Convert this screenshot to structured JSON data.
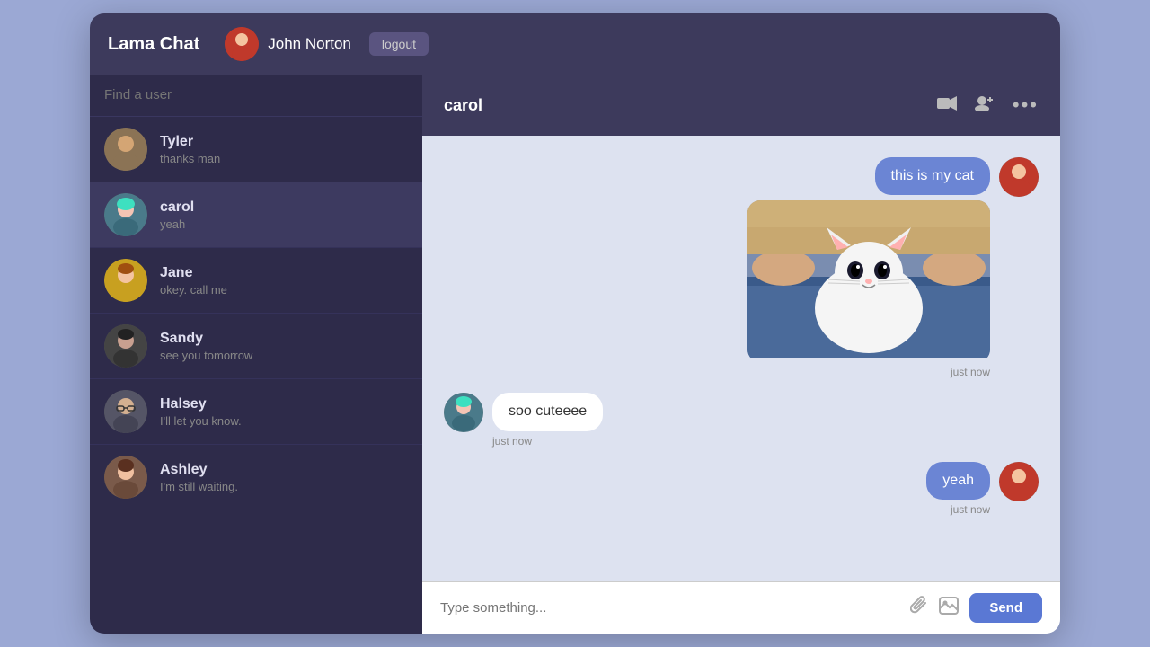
{
  "app": {
    "title": "Lama Chat",
    "logged_in_user": "John Norton",
    "logout_label": "logout"
  },
  "sidebar": {
    "search_placeholder": "Find a user",
    "contacts": [
      {
        "id": "tyler",
        "name": "Tyler",
        "preview": "thanks man",
        "active": false
      },
      {
        "id": "carol",
        "name": "carol",
        "preview": "yeah",
        "active": true
      },
      {
        "id": "jane",
        "name": "Jane",
        "preview": "okey. call me",
        "active": false
      },
      {
        "id": "sandy",
        "name": "Sandy",
        "preview": "see you tomorrow",
        "active": false
      },
      {
        "id": "halsey",
        "name": "Halsey",
        "preview": "I'll let you know.",
        "active": false
      },
      {
        "id": "ashley",
        "name": "Ashley",
        "preview": "I'm still waiting.",
        "active": false
      }
    ]
  },
  "chat": {
    "contact_name": "carol",
    "messages": [
      {
        "id": 1,
        "type": "sent",
        "text": "this is my cat",
        "time": "just now",
        "has_image": true
      },
      {
        "id": 2,
        "type": "received",
        "text": "soo cuteeee",
        "time": "just now",
        "has_image": false
      },
      {
        "id": 3,
        "type": "sent",
        "text": "yeah",
        "time": "just now",
        "has_image": false
      }
    ],
    "input_placeholder": "Type something...",
    "send_label": "Send"
  },
  "icons": {
    "video": "📹",
    "add_user": "👤",
    "more": "⋯",
    "attachment": "📎",
    "image": "🖼",
    "logout": "logout"
  }
}
